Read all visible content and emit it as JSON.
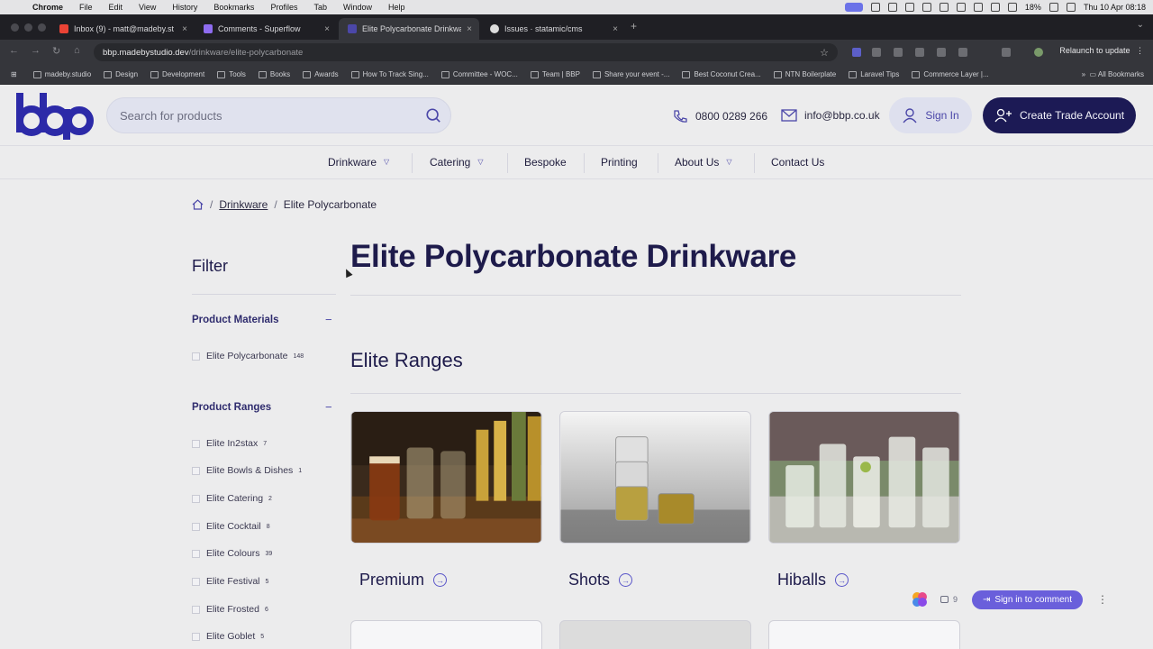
{
  "os_menu": {
    "app": "Chrome",
    "items": [
      "File",
      "Edit",
      "View",
      "History",
      "Bookmarks",
      "Profiles",
      "Tab",
      "Window",
      "Help"
    ],
    "battery": "18%",
    "clock": "Thu 10 Apr  08:18"
  },
  "browser": {
    "tabs": [
      {
        "title": "Inbox (9) - matt@madeby.st",
        "color": "#ea4335"
      },
      {
        "title": "Comments - Superflow",
        "color": "#8e6cf0"
      },
      {
        "title": "Elite Polycarbonate Drinkware",
        "color": "#4b47a8"
      },
      {
        "title": "Issues · statamic/cms",
        "color": "#dddddd"
      }
    ],
    "url_host": "bbp.madebystudio.dev",
    "url_path": "/drinkware/elite-polycarbonate",
    "relaunch": "Relaunch to update",
    "bookmarks": [
      "madeby.studio",
      "Design",
      "Development",
      "Tools",
      "Books",
      "Awards",
      "How To Track Sing...",
      "Committee - WOC...",
      "Team | BBP",
      "Share your event -...",
      "Best Coconut Crea...",
      "NTN Boilerplate",
      "Laravel Tips",
      "Commerce Layer |..."
    ],
    "all_bookmarks": "All Bookmarks"
  },
  "site": {
    "search_placeholder": "Search for products",
    "phone": "0800 0289 266",
    "email": "info@bbp.co.uk",
    "sign_in": "Sign In",
    "trade": "Create Trade Account",
    "brand_color": "#1c1a55",
    "accent_color": "#4b47a8"
  },
  "nav": [
    {
      "label": "Drinkware",
      "dropdown": true
    },
    {
      "label": "Catering",
      "dropdown": true
    },
    {
      "label": "Bespoke",
      "dropdown": false
    },
    {
      "label": "Printing",
      "dropdown": false
    },
    {
      "label": "About Us",
      "dropdown": true
    },
    {
      "label": "Contact Us",
      "dropdown": false
    }
  ],
  "breadcrumb": {
    "parent": "Drinkware",
    "current": "Elite Polycarbonate"
  },
  "filter": {
    "title": "Filter",
    "groups": [
      {
        "title": "Product Materials",
        "items": [
          {
            "label": "Elite Polycarbonate",
            "count": "148"
          }
        ]
      },
      {
        "title": "Product Ranges",
        "items": [
          {
            "label": "Elite In2stax",
            "count": "7"
          },
          {
            "label": "Elite Bowls & Dishes",
            "count": "1"
          },
          {
            "label": "Elite Catering",
            "count": "2"
          },
          {
            "label": "Elite Cocktail",
            "count": "8"
          },
          {
            "label": "Elite Colours",
            "count": "39"
          },
          {
            "label": "Elite Festival",
            "count": "5"
          },
          {
            "label": "Elite Frosted",
            "count": "6"
          },
          {
            "label": "Elite Goblet",
            "count": "5"
          }
        ]
      }
    ]
  },
  "main": {
    "title": "Elite Polycarbonate Drinkware",
    "ranges_title": "Elite Ranges",
    "cards": [
      {
        "label": "Premium"
      },
      {
        "label": "Shots"
      },
      {
        "label": "Hiballs"
      }
    ]
  },
  "comment_bar": {
    "count": "9",
    "button": "Sign in to comment"
  }
}
